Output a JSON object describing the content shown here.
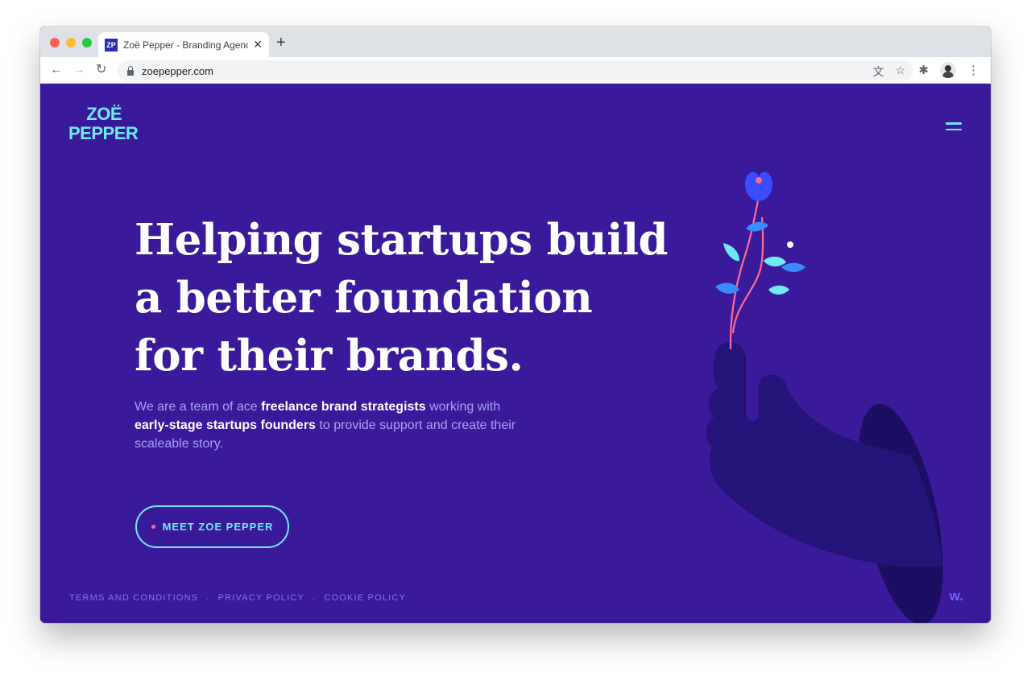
{
  "browser": {
    "tab": {
      "favicon_text": "ZP",
      "title": "Zoë Pepper - Branding Agency",
      "close_glyph": "✕"
    },
    "new_tab_glyph": "+",
    "nav": {
      "back_glyph": "←",
      "forward_glyph": "→",
      "reload_glyph": "↻"
    },
    "url": "zoepepper.com",
    "omnibox_icons": {
      "translate": "文",
      "bookmark": "☆"
    },
    "extensions_glyph": "✱",
    "menu_glyph": "⋮"
  },
  "colors": {
    "page_background": "#3a1a9b",
    "accent_cyan": "#6fe9f2",
    "intro_text": "#a9a1f3",
    "hand": "#24147a",
    "flower": "#3b4bff",
    "stem": "#ff6b8f"
  },
  "site": {
    "logo_line1": "ZOË",
    "logo_line2": "PEPPER",
    "headline": {
      "line1": "Helping startups build",
      "line2": "a better foundation",
      "line3": "for their brands."
    },
    "intro": {
      "part1": "We are a team of ace ",
      "bold1": "freelance brand strategists",
      "part2": " working with ",
      "bold2": "early-stage startups founders",
      "part3": " to provide support and create their scaleable story."
    },
    "cta_label": "MEET ZOE PEPPER",
    "footer_links": [
      "TERMS AND CONDITIONS",
      "PRIVACY POLICY",
      "COOKIE POLICY"
    ],
    "footer_separator": ".",
    "badge": "w."
  }
}
